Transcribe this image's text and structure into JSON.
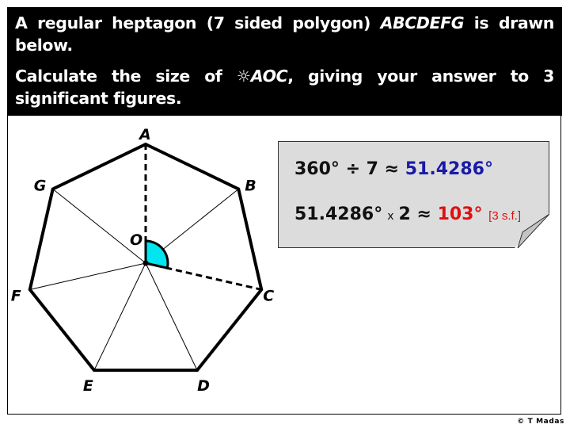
{
  "question": {
    "line1_prefix": "A regular heptagon (7 sided polygon) ",
    "polygon_name": "ABCDEFG",
    "line1_suffix": " is drawn below.",
    "line2_prefix": "Calculate the size of ",
    "angle_symbol": "☼",
    "angle_name": "AOC",
    "line2_suffix": ", giving your answer to 3 significant figures."
  },
  "diagram": {
    "vertex_labels": [
      "A",
      "B",
      "C",
      "D",
      "E",
      "F",
      "G"
    ],
    "centre_label": "O",
    "sides": 7,
    "highlighted_angle": "AOC",
    "colors": {
      "polygon": "#000000",
      "angle_fill": "#00e5f0",
      "box": "#dcdcdc"
    }
  },
  "calculation": {
    "step1_left": "360° ÷ 7 ≈ ",
    "step1_result": "51.4286°",
    "step2_left": "51.4286°",
    "step2_times": "x",
    "step2_mid": "2 ≈ ",
    "step2_result": "103°",
    "step2_note": "[3 s.f.]",
    "colors": {
      "step1_result": "#1a1aa8",
      "step2_result": "#e01010"
    }
  },
  "footer": {
    "copyright": "© T Madas"
  }
}
